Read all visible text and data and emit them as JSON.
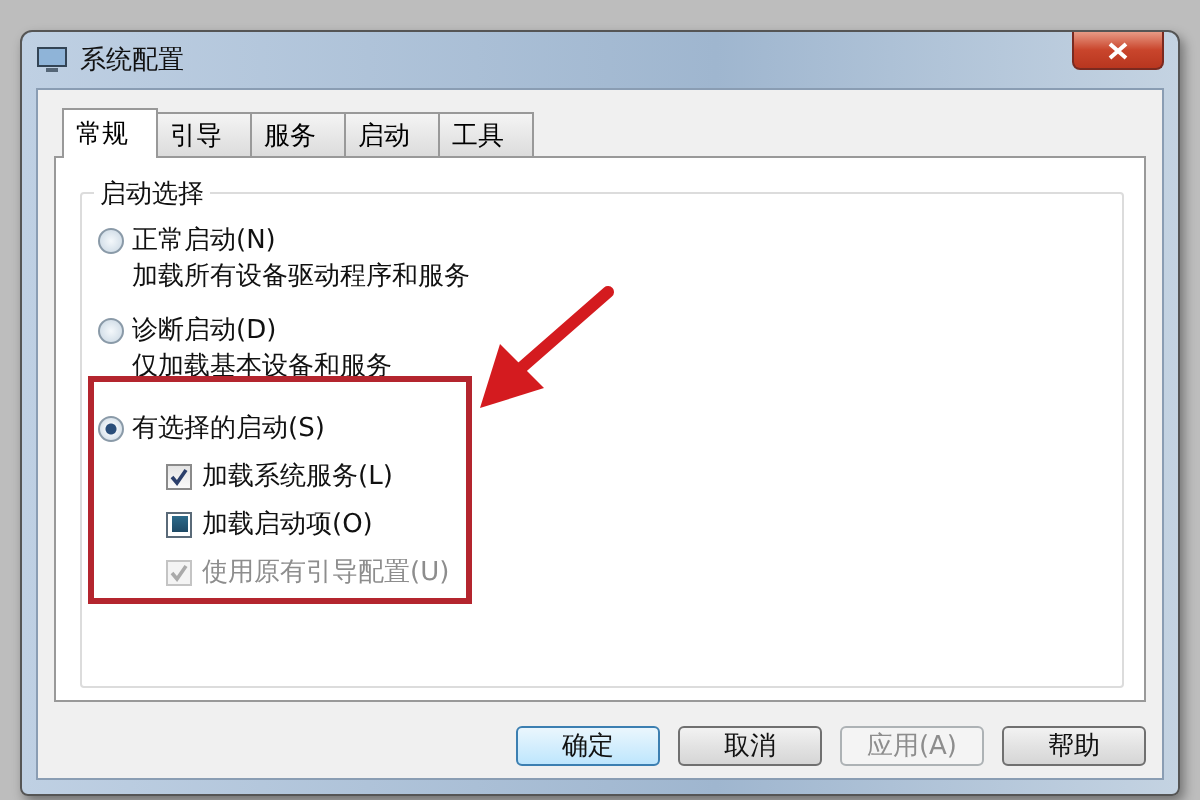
{
  "window": {
    "title": "系统配置"
  },
  "tabs": [
    {
      "label": "常规",
      "selected": true
    },
    {
      "label": "引导",
      "selected": false
    },
    {
      "label": "服务",
      "selected": false
    },
    {
      "label": "启动",
      "selected": false
    },
    {
      "label": "工具",
      "selected": false
    }
  ],
  "group": {
    "title": "启动选择"
  },
  "options": [
    {
      "label": "正常启动(N)",
      "description": "加载所有设备驱动程序和服务",
      "selected": false
    },
    {
      "label": "诊断启动(D)",
      "description": "仅加载基本设备和服务",
      "selected": false
    },
    {
      "label": "有选择的启动(S)",
      "selected": true
    }
  ],
  "checkboxes": [
    {
      "label": "加载系统服务(L)",
      "checked": true,
      "indeterminate": false,
      "disabled": false
    },
    {
      "label": "加载启动项(O)",
      "checked": false,
      "indeterminate": true,
      "disabled": false
    },
    {
      "label": "使用原有引导配置(U)",
      "checked": true,
      "indeterminate": false,
      "disabled": true
    }
  ],
  "buttons": [
    {
      "label": "确定",
      "default": true,
      "disabled": false
    },
    {
      "label": "取消",
      "default": false,
      "disabled": false
    },
    {
      "label": "应用(A)",
      "default": false,
      "disabled": true
    },
    {
      "label": "帮助",
      "default": false,
      "disabled": false
    }
  ]
}
